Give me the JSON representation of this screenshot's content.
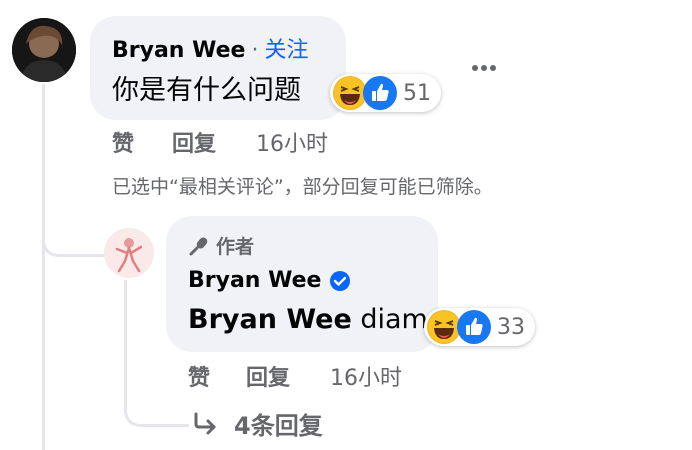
{
  "comment": {
    "author": "Bryan Wee",
    "separator": "·",
    "follow_label": "关注",
    "text": "你是有什么问题",
    "reaction_count": "51",
    "actions": {
      "like": "赞",
      "reply": "回复",
      "time": "16小时"
    }
  },
  "filter_notice": "已选中“最相关评论”，部分回复可能已筛除。",
  "reply": {
    "badge_label": "作者",
    "author": "Bryan Wee",
    "mention": "Bryan Wee",
    "text": " diam",
    "reaction_count": "33",
    "actions": {
      "like": "赞",
      "reply": "回复",
      "time": "16小时"
    }
  },
  "more_replies": "4条回复",
  "colors": {
    "link": "#0866ff",
    "muted": "#65676b",
    "bubble": "#f0f2f5",
    "thread_line": "#e4e6eb"
  },
  "icons": [
    "more-icon",
    "laugh-icon",
    "like-icon",
    "microphone-icon",
    "verified-icon",
    "reply-arrow-icon"
  ]
}
